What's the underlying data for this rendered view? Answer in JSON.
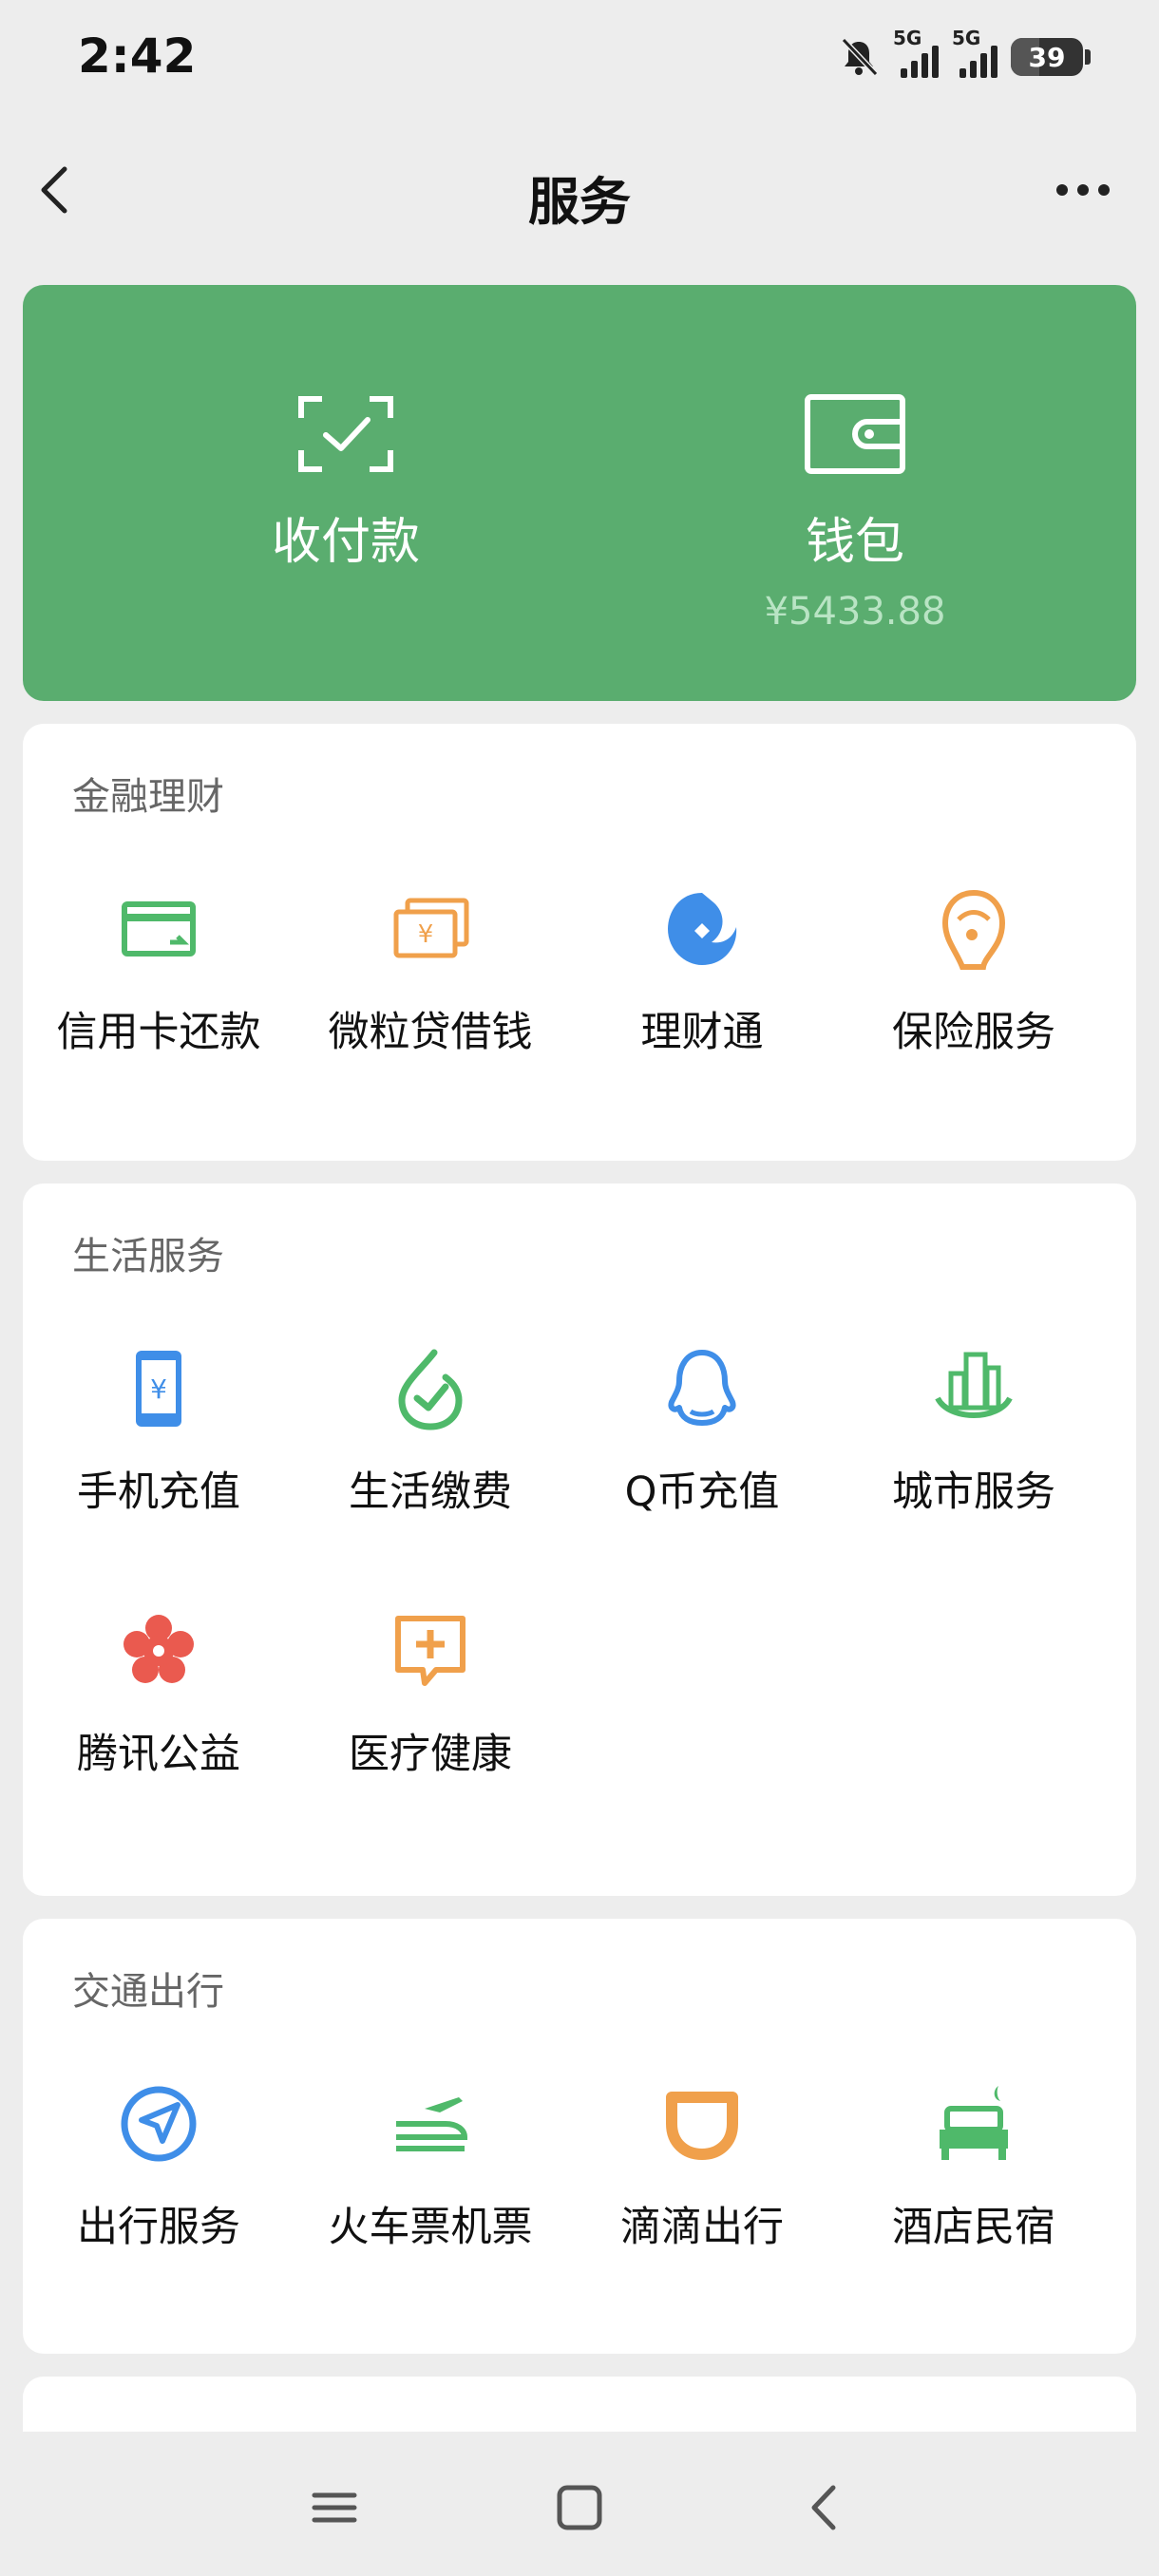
{
  "status_bar": {
    "time": "2:42",
    "network_1": "5G",
    "network_2": "5G",
    "battery": "39"
  },
  "header": {
    "title": "服务"
  },
  "hero": {
    "pay_label": "收付款",
    "wallet_label": "钱包",
    "wallet_balance": "¥5433.88"
  },
  "sections": [
    {
      "title": "金融理财",
      "items": [
        {
          "label": "信用卡还款",
          "icon": "credit-card-icon",
          "color": "#4fb96a"
        },
        {
          "label": "微粒贷借钱",
          "icon": "loan-money-icon",
          "color": "#f0a04b"
        },
        {
          "label": "理财通",
          "icon": "wealth-icon",
          "color": "#3f8ee8"
        },
        {
          "label": "保险服务",
          "icon": "insurance-icon",
          "color": "#f0a04b"
        }
      ]
    },
    {
      "title": "生活服务",
      "items": [
        {
          "label": "手机充值",
          "icon": "phone-topup-icon",
          "color": "#3f8ee8"
        },
        {
          "label": "生活缴费",
          "icon": "utility-bill-icon",
          "color": "#4fb96a"
        },
        {
          "label": "Q币充值",
          "icon": "qq-coin-icon",
          "color": "#3f8ee8"
        },
        {
          "label": "城市服务",
          "icon": "city-service-icon",
          "color": "#4fb96a"
        },
        {
          "label": "腾讯公益",
          "icon": "charity-flower-icon",
          "color": "#ea5a4f"
        },
        {
          "label": "医疗健康",
          "icon": "medical-icon",
          "color": "#f0a04b"
        }
      ]
    },
    {
      "title": "交通出行",
      "items": [
        {
          "label": "出行服务",
          "icon": "navigation-arrow-icon",
          "color": "#3f8ee8"
        },
        {
          "label": "火车票机票",
          "icon": "train-plane-icon",
          "color": "#4fb96a"
        },
        {
          "label": "滴滴出行",
          "icon": "didi-icon",
          "color": "#f0a04b"
        },
        {
          "label": "酒店民宿",
          "icon": "hotel-bed-icon",
          "color": "#4fb96a"
        }
      ]
    }
  ],
  "colors": {
    "hero_green": "#5aad6f",
    "page_bg": "#ededed"
  }
}
